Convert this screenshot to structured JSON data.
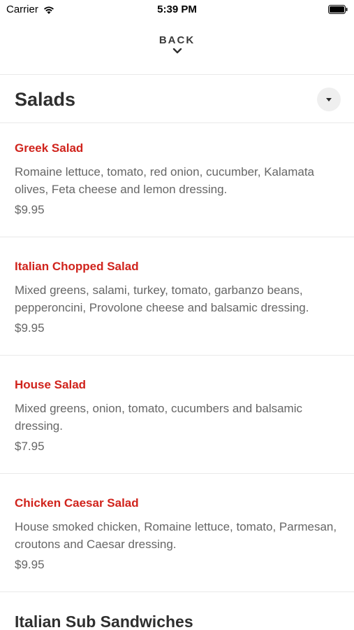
{
  "status_bar": {
    "carrier": "Carrier",
    "time": "5:39 PM"
  },
  "nav": {
    "back_label": "BACK"
  },
  "section": {
    "title": "Salads"
  },
  "items": [
    {
      "name": "Greek Salad",
      "description": "Romaine lettuce, tomato, red onion, cucumber, Kalamata olives, Feta cheese and lemon dressing.",
      "price": "$9.95"
    },
    {
      "name": "Italian Chopped Salad",
      "description": "Mixed greens, salami, turkey, tomato, garbanzo beans, pepperoncini, Provolone cheese and balsamic dressing.",
      "price": "$9.95"
    },
    {
      "name": "House Salad",
      "description": "Mixed greens, onion, tomato, cucumbers and balsamic dressing.",
      "price": "$7.95"
    },
    {
      "name": "Chicken Caesar Salad",
      "description": "House smoked chicken, Romaine lettuce, tomato, Parmesan, croutons and Caesar dressing.",
      "price": "$9.95"
    }
  ],
  "next_section": {
    "title": "Italian Sub Sandwiches"
  },
  "colors": {
    "item_name": "#d0231c",
    "text_secondary": "#666666",
    "heading": "#2f2f2f"
  },
  "icons": {
    "wifi": "wifi-icon",
    "battery": "battery-icon",
    "back": "chevron-down-icon",
    "dropdown": "caret-down-icon"
  }
}
